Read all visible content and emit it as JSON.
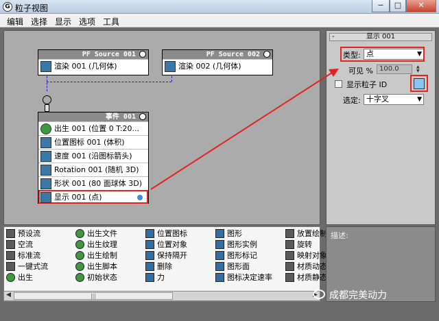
{
  "window": {
    "title": "粒子视图",
    "minimize": "−",
    "maximize": "□",
    "close": "✕"
  },
  "menu": [
    "编辑",
    "选择",
    "显示",
    "选项",
    "工具"
  ],
  "nodes": {
    "source1": {
      "title": "PF Source 001",
      "row": "渲染 001 (几何体)"
    },
    "source2": {
      "title": "PF Source 002",
      "row": "渲染 002 (几何体)"
    },
    "event": {
      "title": "事件 001",
      "rows": [
        "出生 001 (位置 0 T:20...",
        "位置图标 001 (体积)",
        "速度 001 (沿图标箭头)",
        "Rotation 001 (随机 3D)",
        "形状 001 (80 面球体 3D)",
        "显示 001 (点)"
      ]
    }
  },
  "panel": {
    "rollout_title": "显示 001",
    "rollout_toggle": "-",
    "type_label": "类型:",
    "type_value": "点",
    "visible_label": "可见 %",
    "visible_value": "100.0",
    "show_id_label": "显示粒子 ID",
    "selected_label": "选定:",
    "selected_value": "十字叉",
    "swatch_color": "#8cc4f0"
  },
  "depot": {
    "col1": [
      "预设流",
      "空流",
      "标准流",
      "一键式流",
      "出生"
    ],
    "col2": [
      "出生文件",
      "出生纹理",
      "出生绘制",
      "出生脚本",
      "初始状态"
    ],
    "col3": [
      "位置图标",
      "位置对象",
      "保持隔开",
      "删除",
      "力"
    ],
    "col4": [
      "图形",
      "图形实例",
      "图形标记",
      "图形面",
      "图标决定速率"
    ],
    "col5": [
      "放置绘制",
      "旋转",
      "映射对象",
      "材质动态",
      "材质静态"
    ]
  },
  "scroll": {
    "thumb": "|||",
    "left": "◀",
    "right": "▶"
  },
  "description": {
    "label": "描述:"
  },
  "watermark": {
    "text": "成都完美动力"
  },
  "colors": {
    "highlight": "#e52222",
    "wire": "#2020c0"
  }
}
